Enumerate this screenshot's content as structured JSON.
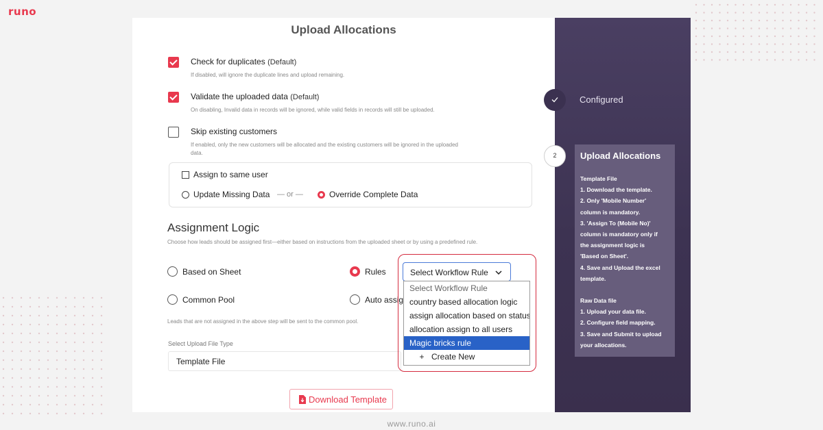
{
  "brand": {
    "logo_text": "runo",
    "footer_url": "www.runo.ai",
    "accent": "#e8394e",
    "sidebar_bg": "#3d3352"
  },
  "form": {
    "title": "Upload Allocations",
    "checkboxes": [
      {
        "label": "Check for duplicates",
        "suffix": "(Default)",
        "checked": true,
        "help": "If disabled, will ignore the duplicate lines and upload remaining."
      },
      {
        "label": "Validate the uploaded data",
        "suffix": "(Default)",
        "checked": true,
        "help": "On disabling, Invalid data in records will be ignored, while valid fields in records will still be uploaded."
      },
      {
        "label": "Skip existing customers",
        "suffix": "",
        "checked": false,
        "help": "If enabled, only the new customers will be allocated and the existing customers will be ignored in the uploaded data."
      }
    ],
    "options": {
      "assign_same_user": "Assign to same user",
      "update_missing": "Update Missing Data",
      "or_separator": "— or —",
      "override_complete": "Override Complete Data",
      "selected": "override_complete"
    },
    "assignment": {
      "heading": "Assignment Logic",
      "help": "Choose how leads should be assigned first—either based on instructions from the uploaded sheet or by using a predefined rule.",
      "choices": [
        "Based on Sheet",
        "Rules",
        "Common Pool",
        "Auto assig"
      ],
      "selected": "Rules",
      "pool_note": "Leads that are not assigned in the above step will be sent to the common pool."
    },
    "workflow_select": {
      "value": "Select Workflow Rule",
      "options": [
        "Select Workflow Rule",
        "country based allocation logic",
        "assign allocation based on status",
        "allocation assign to all users",
        "Magic bricks rule"
      ],
      "highlighted": "Magic bricks rule",
      "create_plus": "+",
      "create_label": "Create New"
    },
    "upload": {
      "label": "Select Upload File Type",
      "value": "Template File"
    },
    "download_button": "Download Template"
  },
  "steps": {
    "step1_label": "Configured",
    "step2_number": "2",
    "step2_title": "Upload Allocations",
    "instructions": [
      "Template File",
      "1. Download the template.",
      "2. Only 'Mobile Number'",
      "column is mandatory.",
      "3. 'Assign To (Mobile No)'",
      "column is mandatory only if",
      "the assignment logic is",
      "'Based on Sheet'.",
      "4. Save and Upload the excel",
      "template.",
      "",
      "Raw Data file",
      "1. Upload your data file.",
      "2. Configure field mapping.",
      "3. Save and Submit to upload",
      "your allocations."
    ]
  }
}
